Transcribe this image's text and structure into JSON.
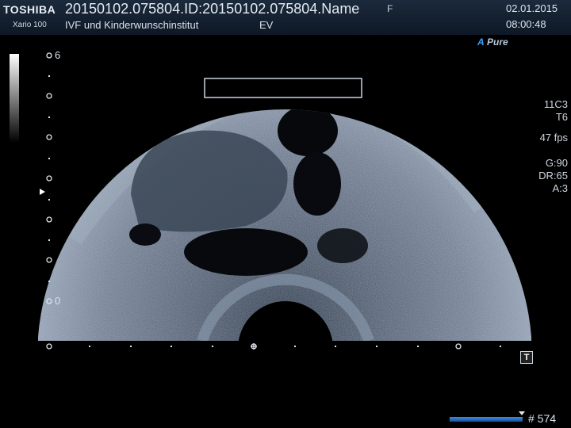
{
  "header": {
    "brand": "TOSHIBA",
    "model": "Xario 100",
    "study_id": "20150102.075804.ID:20150102.075804.Name",
    "institution": "IVF und Kinderwunschinstitut",
    "mode": "EV",
    "flag": "F",
    "date": "02.01.2015",
    "time": "08:00:48"
  },
  "processing": {
    "mode_prefix": "A",
    "mode_name": "Pure"
  },
  "probe": {
    "model": "11C3",
    "preset": "T6"
  },
  "frame_rate": "47 fps",
  "gain": {
    "g": "G:90",
    "dr": "DR:65",
    "a": "A:3"
  },
  "depth_scale": {
    "top_label": "6",
    "bottom_label": "0"
  },
  "cine": {
    "frame_label": "# 574"
  },
  "controls": {
    "t_button": "T"
  },
  "colors": {
    "header_bg": "#1b2a3c",
    "cine_bar": "#3a8ee8",
    "brand_text": "#e8eef6"
  },
  "icons": {
    "t_button": "text-annotation-icon",
    "cine_marker": "triangle-down-icon",
    "focus_marker": "triangle-right-icon"
  }
}
